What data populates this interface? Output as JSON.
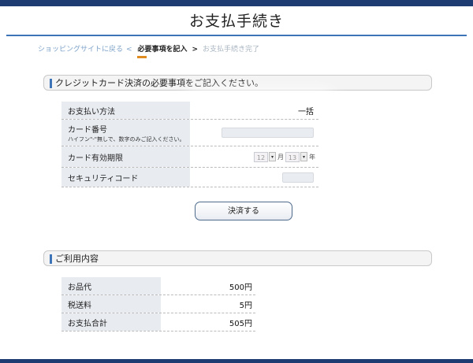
{
  "page": {
    "title": "お支払手続き"
  },
  "breadcrumb": {
    "back_link": "ショッピングサイトに戻る",
    "separator": "<",
    "current": "必要事項を記入",
    "current_arrow": ">",
    "next": "お支払手続き完了"
  },
  "payment_section": {
    "heading": "クレジットカード決済の必要事項をご記入ください。",
    "rows": [
      {
        "label": "お支払い方法",
        "value": "一括"
      },
      {
        "label": "カード番号",
        "note": "ハイフン\"-\"無しで、数字のみご記入ください。",
        "value": ""
      },
      {
        "label": "カード有効期限",
        "month": "12",
        "month_unit": "月",
        "year": "13",
        "year_unit": "年"
      },
      {
        "label": "セキュリティコード",
        "value": ""
      }
    ],
    "submit_label": "決済する"
  },
  "order_section": {
    "heading": "ご利用内容",
    "rows": [
      {
        "label": "お品代",
        "value": "500円"
      },
      {
        "label": "税送料",
        "value": "5円"
      },
      {
        "label": "お支払合計",
        "value": "505円"
      }
    ]
  },
  "colors": {
    "accent": "#3d74b8",
    "header_bar": "#1e3c72",
    "label_bg": "#e8ebf0"
  }
}
